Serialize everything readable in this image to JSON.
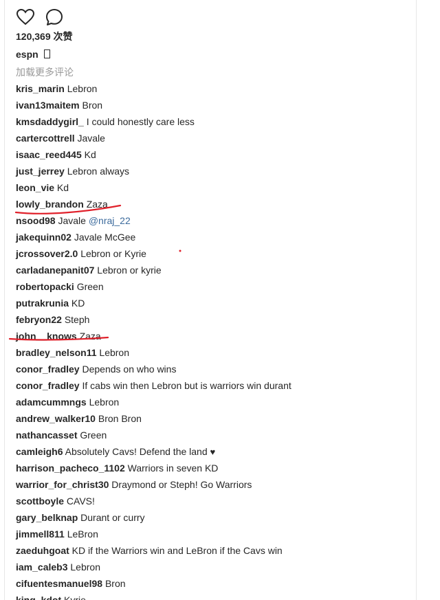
{
  "actions": {
    "like_icon": "heart-outline",
    "comment_icon": "speech-bubble"
  },
  "likes": {
    "label": "120,369 次赞"
  },
  "caption": {
    "username": "espn",
    "glyph": "□"
  },
  "load_more": {
    "label": "加载更多评论"
  },
  "comments": [
    {
      "user": "kris_marin",
      "text": "Lebron"
    },
    {
      "user": "ivan13maitem",
      "text": "Bron"
    },
    {
      "user": "kmsdaddygirl_",
      "text": "I could honestly care less"
    },
    {
      "user": "cartercottrell",
      "text": "Javale"
    },
    {
      "user": "isaac_reed445",
      "text": "Kd"
    },
    {
      "user": "just_jerrey",
      "text": "Lebron always"
    },
    {
      "user": "leon_vie",
      "text": "Kd"
    },
    {
      "user": "lowly_brandon",
      "text": "Zaza"
    },
    {
      "user": "nsood98",
      "text": "Javale ",
      "mention": "@nraj_22"
    },
    {
      "user": "jakequinn02",
      "text": "Javale McGee"
    },
    {
      "user": "jcrossover2.0",
      "text": "Lebron or Kyrie"
    },
    {
      "user": "carladanepanit07",
      "text": "Lebron or kyrie"
    },
    {
      "user": "robertopacki",
      "text": "Green"
    },
    {
      "user": "putrakrunia",
      "text": "KD"
    },
    {
      "user": "febryon22",
      "text": "Steph"
    },
    {
      "user": "john__knows",
      "text": "Zaza"
    },
    {
      "user": "bradley_nelson11",
      "text": "Lebron"
    },
    {
      "user": "conor_fradley",
      "text": "Depends on who wins"
    },
    {
      "user": "conor_fradley",
      "text": "If cabs win then Lebron but is warriors win durant"
    },
    {
      "user": "adamcummngs",
      "text": "Lebron"
    },
    {
      "user": "andrew_walker10",
      "text": "Bron Bron"
    },
    {
      "user": "nathancasset",
      "text": "Green"
    },
    {
      "user": "camleigh6",
      "text": "Absolutely Cavs! Defend the land ",
      "emoji": "♥"
    },
    {
      "user": "harrison_pacheco_1102",
      "text": "Warriors in seven KD"
    },
    {
      "user": "warrior_for_christ30",
      "text": "Draymond or Steph! Go Warriors"
    },
    {
      "user": "scottboyle",
      "text": "CAVS!"
    },
    {
      "user": "gary_belknap",
      "text": "Durant or curry"
    },
    {
      "user": "jimmell811",
      "text": "LeBron"
    },
    {
      "user": "zaeduhgoat",
      "text": "KD if the Warriors win and LeBron if the Cavs win"
    },
    {
      "user": "iam_caleb3",
      "text": "Lebron"
    },
    {
      "user": "cifuentesmanuel98",
      "text": "Bron"
    },
    {
      "user": "king_kdot",
      "text": "Kyrie"
    }
  ],
  "colors": {
    "text": "#262626",
    "muted": "#999999",
    "mention": "#3b6a9c",
    "annotation": "#e0202a",
    "border": "#e6e6e6"
  }
}
